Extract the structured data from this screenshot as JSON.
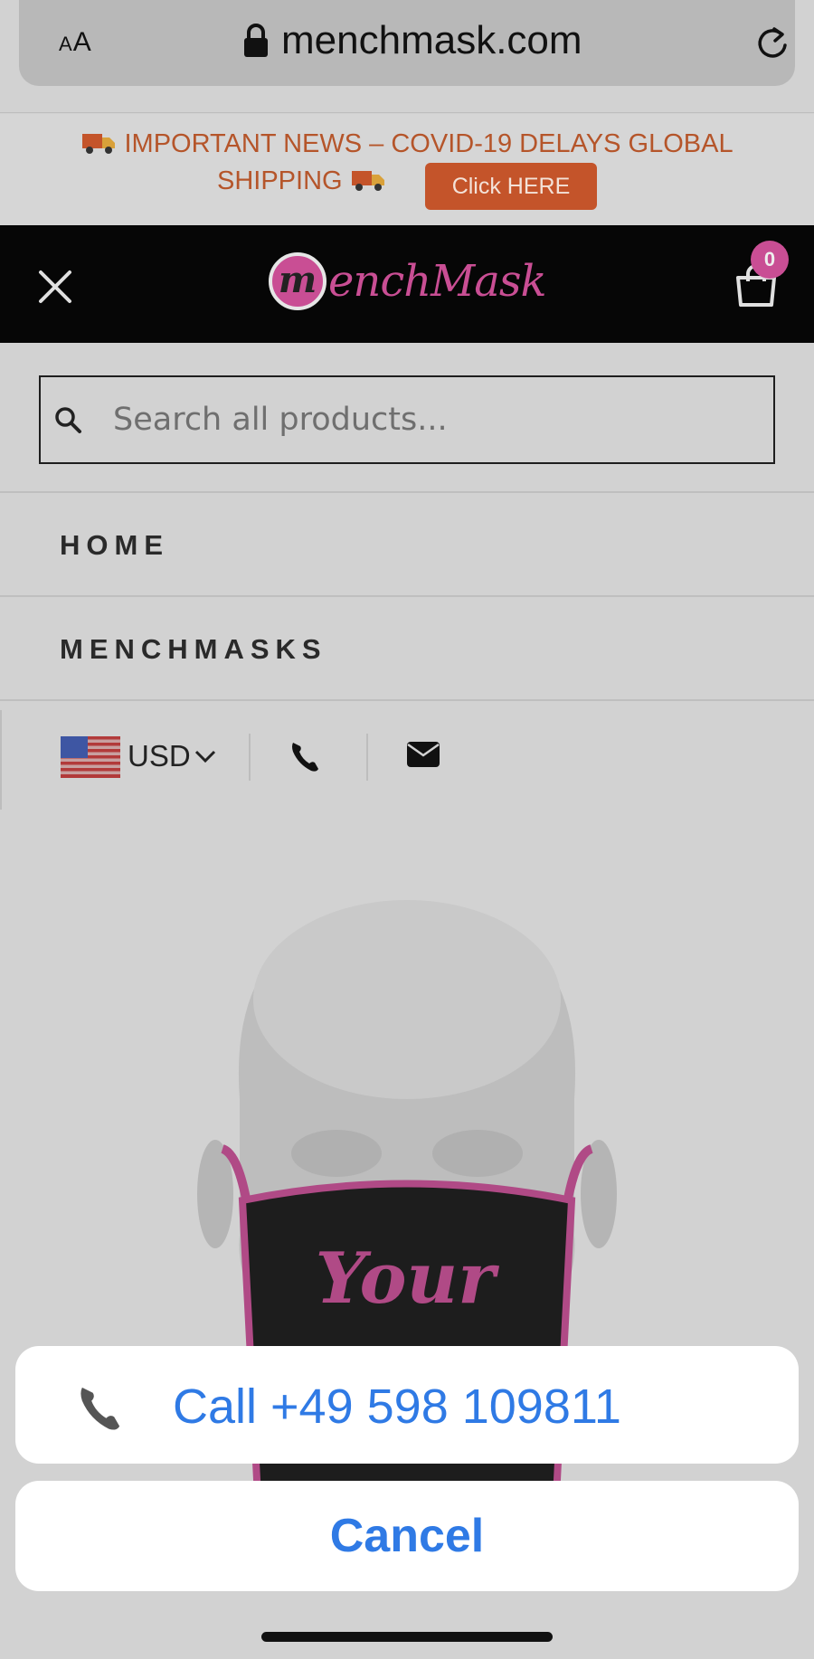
{
  "browser": {
    "text_size_label": "AA",
    "url": "menchmask.com",
    "icons": {
      "lock": "lock-icon",
      "reload": "reload-icon"
    }
  },
  "announcement": {
    "line1": "IMPORTANT NEWS – COVID-19 DELAYS GLOBAL",
    "line2": "SHIPPING",
    "button_label": "Click HERE",
    "text_color": "#b5552a",
    "button_color": "#c4542a"
  },
  "header": {
    "logo_initial": "m",
    "logo_text": "enchMask",
    "cart_count": "0",
    "brand_color": "#c94e94"
  },
  "search": {
    "placeholder": "Search all products..."
  },
  "nav": {
    "items": [
      {
        "label": "HOME"
      },
      {
        "label": "MENCHMASKS"
      }
    ]
  },
  "utility": {
    "currency": "USD"
  },
  "product": {
    "mask_text": "Your"
  },
  "action_sheet": {
    "call_label": "Call +49 598 109811",
    "cancel_label": "Cancel",
    "accent_color": "#2f7ae5"
  }
}
